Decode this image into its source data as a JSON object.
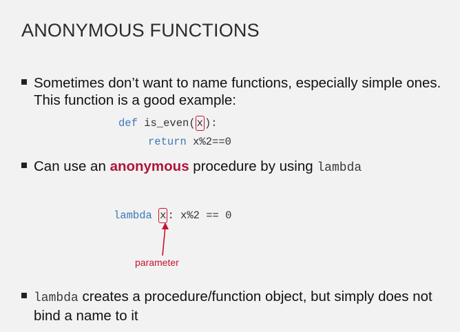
{
  "slide": {
    "title": "ANONYMOUS FUNCTIONS",
    "bullet1": {
      "text": "Sometimes don’t want to name functions, especially simple ones. This function is a good example:"
    },
    "code_def": {
      "def_kw": "def",
      "rest_before": " is_even",
      "param": "x",
      "rest_after": ":"
    },
    "code_return": {
      "return_kw": "return",
      "rest": " x%2==0"
    },
    "bullet2": {
      "text_before": "Can use an ",
      "highlight": "anonymous",
      "text_middle": " procedure by using ",
      "code": "lambda"
    },
    "code_lambda": {
      "lambda_kw": "lambda",
      "param": "x",
      "rest": ": x%2 == 0"
    },
    "annotation": "parameter",
    "bullet3": {
      "code": "lambda",
      "text": " creates a procedure/function object, but simply does not bind a name to it"
    },
    "colors": {
      "accent_red": "#c8102e",
      "anonymous_red": "#b0143a",
      "keyword_blue": "#3a78b8",
      "background": "#f2f2f2"
    }
  }
}
